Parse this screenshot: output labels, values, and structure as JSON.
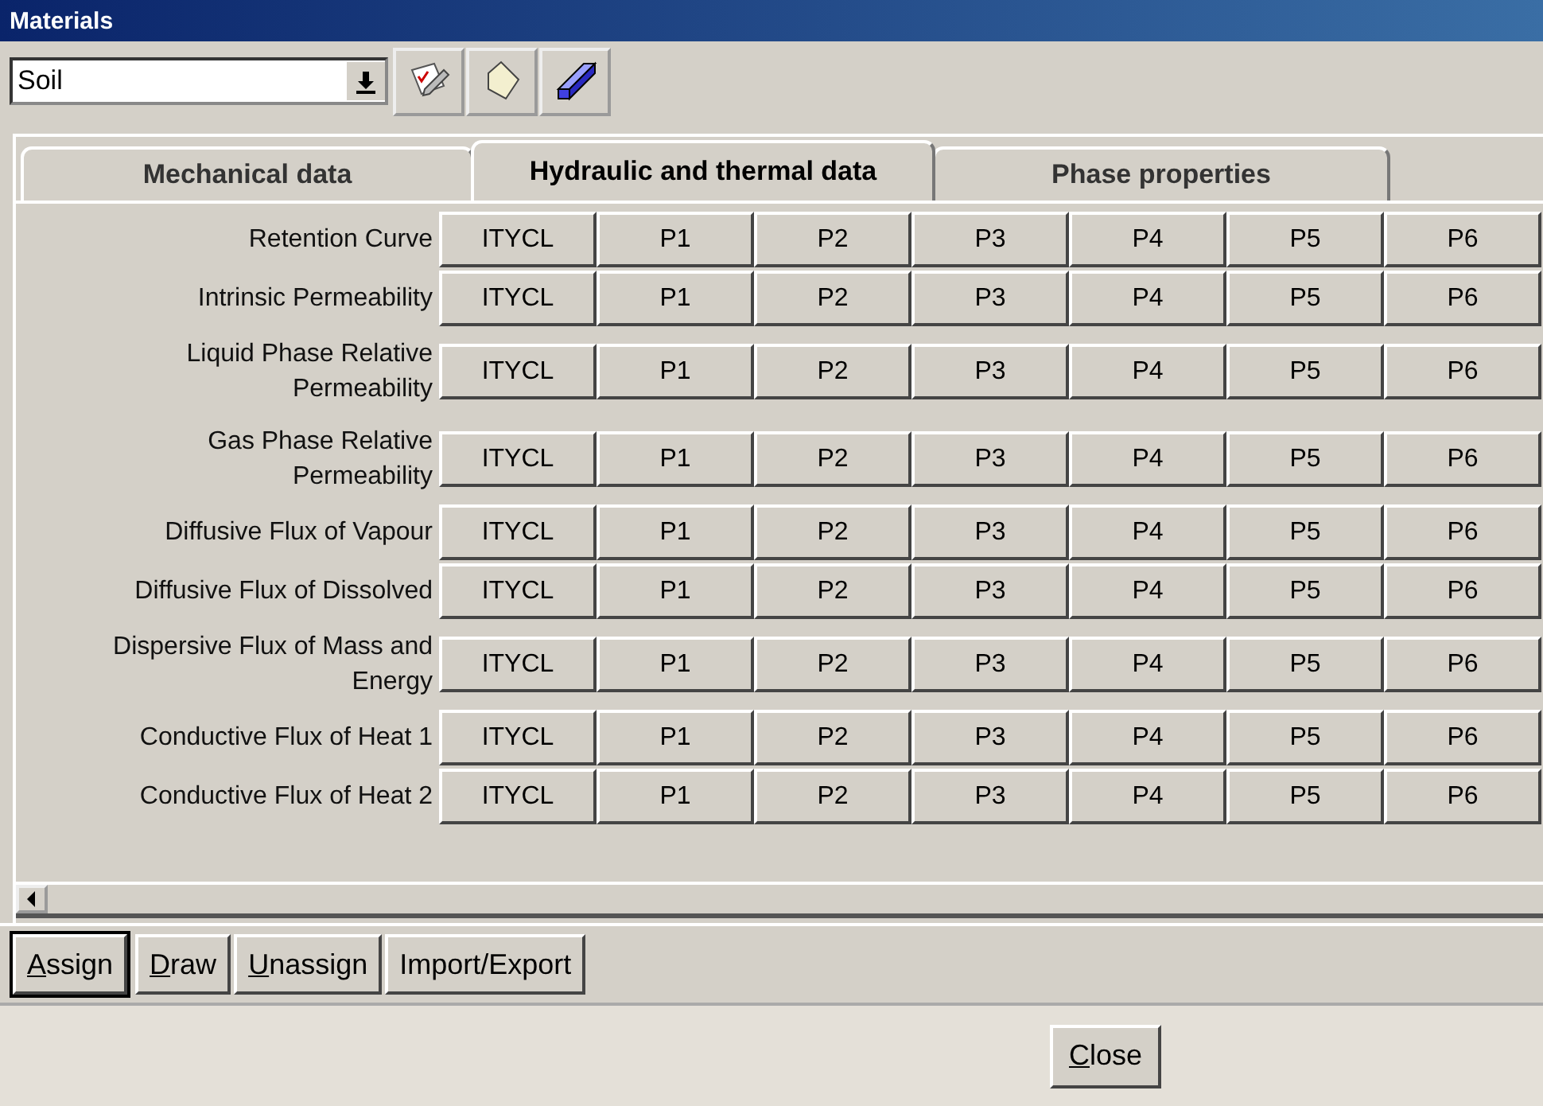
{
  "window": {
    "title": "Materials"
  },
  "toolbar": {
    "material": {
      "value": "Soil"
    },
    "tools": [
      {
        "kind": "edit"
      },
      {
        "kind": "sheet"
      },
      {
        "kind": "block"
      }
    ]
  },
  "tabs": [
    {
      "label": "Mechanical data",
      "selected": false
    },
    {
      "label": "Hydraulic and thermal data",
      "selected": true
    },
    {
      "label": "Phase properties",
      "selected": false
    }
  ],
  "table": {
    "rows": [
      {
        "label": "Retention Curve",
        "cells": [
          "ITYCL",
          "P1",
          "P2",
          "P3",
          "P4",
          "P5",
          "P6"
        ]
      },
      {
        "label": "Intrinsic Permeability",
        "cells": [
          "ITYCL",
          "P1",
          "P2",
          "P3",
          "P4",
          "P5",
          "P6"
        ]
      },
      {
        "label": "Liquid Phase Relative Permeability",
        "cells": [
          "ITYCL",
          "P1",
          "P2",
          "P3",
          "P4",
          "P5",
          "P6"
        ]
      },
      {
        "label": "Gas Phase Relative Permeability",
        "cells": [
          "ITYCL",
          "P1",
          "P2",
          "P3",
          "P4",
          "P5",
          "P6"
        ]
      },
      {
        "label": "Diffusive Flux of Vapour",
        "cells": [
          "ITYCL",
          "P1",
          "P2",
          "P3",
          "P4",
          "P5",
          "P6"
        ]
      },
      {
        "label": "Diffusive Flux of Dissolved",
        "cells": [
          "ITYCL",
          "P1",
          "P2",
          "P3",
          "P4",
          "P5",
          "P6"
        ]
      },
      {
        "label": "Dispersive Flux of Mass and Energy",
        "cells": [
          "ITYCL",
          "P1",
          "P2",
          "P3",
          "P4",
          "P5",
          "P6"
        ]
      },
      {
        "label": "Conductive Flux of Heat 1",
        "cells": [
          "ITYCL",
          "P1",
          "P2",
          "P3",
          "P4",
          "P5",
          "P6"
        ]
      },
      {
        "label": "Conductive Flux of Heat 2",
        "cells": [
          "ITYCL",
          "P1",
          "P2",
          "P3",
          "P4",
          "P5",
          "P6"
        ]
      }
    ]
  },
  "actions": [
    {
      "label": "Assign",
      "mnemonic": true,
      "default": true
    },
    {
      "label": "Draw",
      "mnemonic": true,
      "default": false
    },
    {
      "label": "Unassign",
      "mnemonic": true,
      "default": false
    },
    {
      "label": "Import/Export",
      "mnemonic": false,
      "default": false
    }
  ],
  "close_button": {
    "label": "Close",
    "mnemonic": true
  }
}
